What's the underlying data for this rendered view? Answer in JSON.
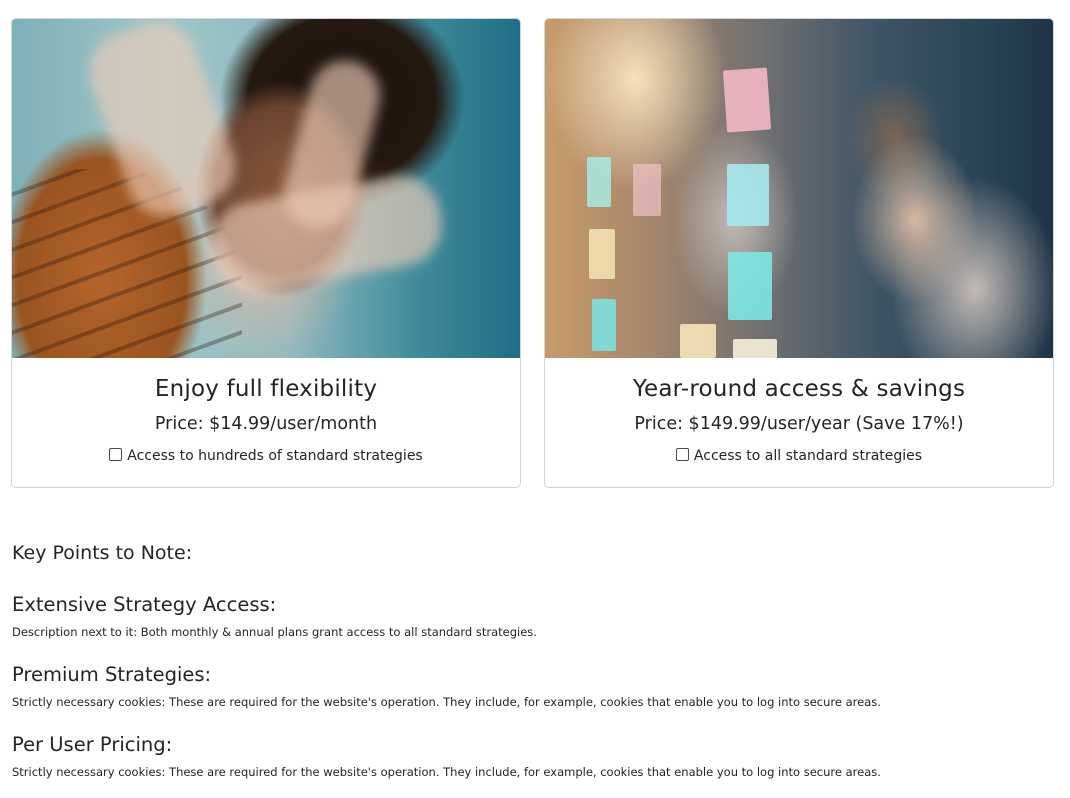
{
  "plans": [
    {
      "title": "Enjoy full flexibility",
      "price": "Price: $14.99/user/month",
      "feature": "Access to hundreds of standard strategies"
    },
    {
      "title": "Year-round access & savings",
      "price": "Price: $149.99/user/year (Save 17%!)",
      "feature": "Access to all standard strategies"
    }
  ],
  "key_points": {
    "heading": "Key Points to Note:",
    "items": [
      {
        "title": "Extensive Strategy Access:",
        "description": "Description next to it: Both monthly & annual plans grant access to all standard strategies."
      },
      {
        "title": "Premium Strategies:",
        "description": "Strictly necessary cookies: These are required for the website's operation. They include, for example, cookies that enable you to log into secure areas."
      },
      {
        "title": "Per User Pricing:",
        "description": "Strictly necessary cookies: These are required for the website's operation. They include, for example, cookies that enable you to log into secure areas."
      }
    ]
  },
  "colors": {
    "text": "#212529",
    "card_border": "#d2d4d7",
    "background": "#ffffff"
  }
}
